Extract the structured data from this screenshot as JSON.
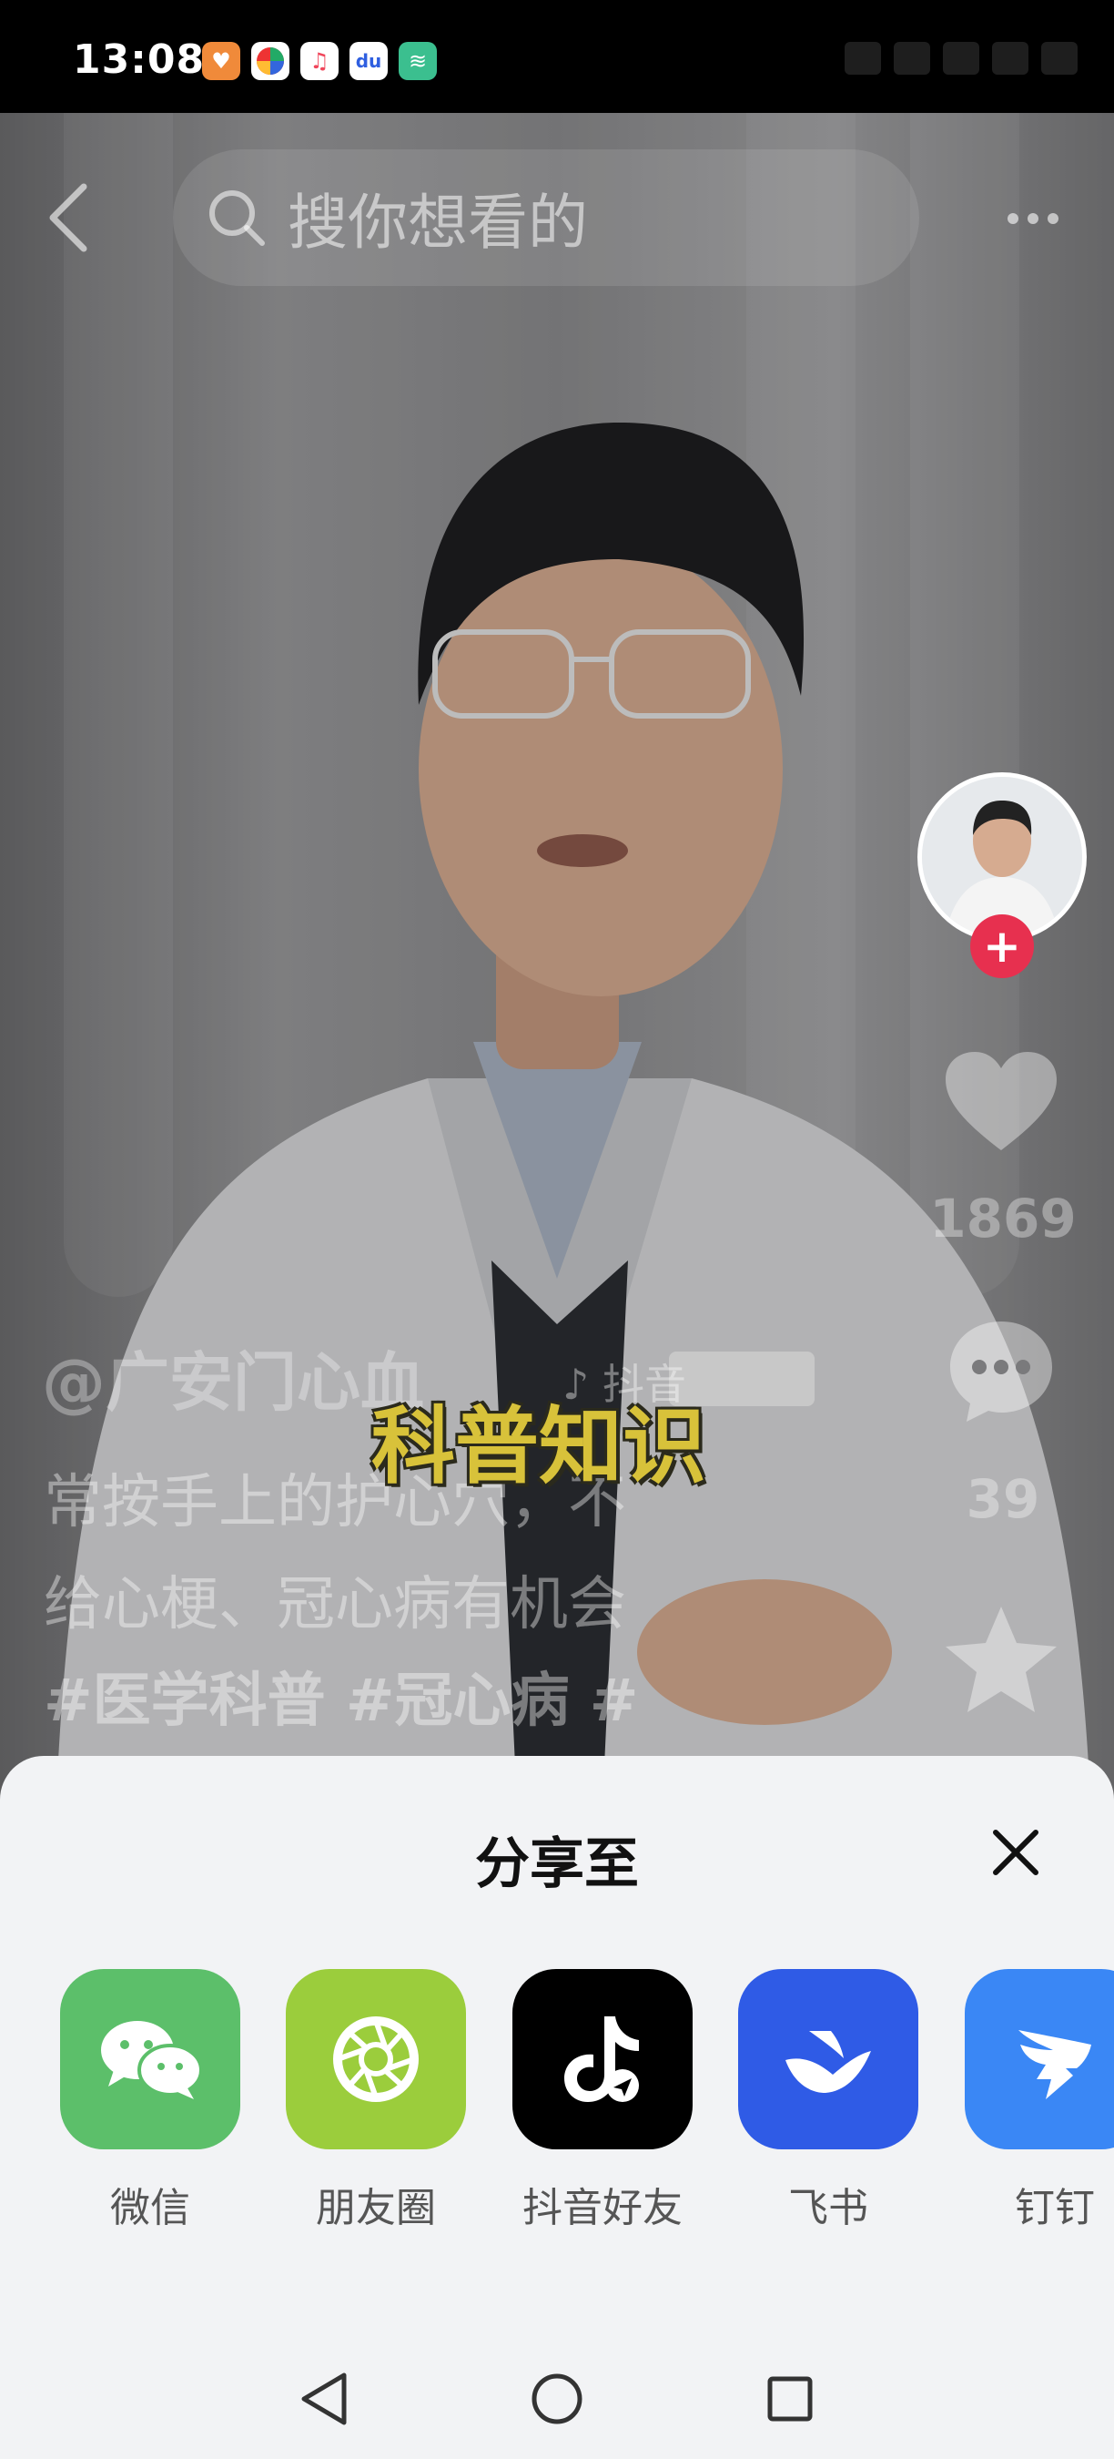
{
  "status_bar": {
    "time": "13:08",
    "apps": [
      {
        "name": "health-app",
        "color": "#f08a3a",
        "glyph": "♥"
      },
      {
        "name": "photos-app",
        "color": "#222222",
        "glyph": "◆"
      },
      {
        "name": "music-app",
        "color": "#ffffff",
        "glyph": "♫"
      },
      {
        "name": "baidu-app",
        "color": "#2f5fe0",
        "glyph": "du"
      },
      {
        "name": "wifi-app",
        "color": "#3bbf8f",
        "glyph": "≋"
      }
    ]
  },
  "video": {
    "search_placeholder": "搜你想看的",
    "author": "@广安门心血",
    "watermark": "♪ 抖音",
    "burned_caption": "科普知识",
    "caption_lines": [
      "常按手上的护心穴，不",
      "给心梗、冠心病有机会"
    ],
    "hashtags": "#医学科普 #冠心病 #",
    "likes": "1869",
    "comments": "39"
  },
  "share_sheet": {
    "title": "分享至",
    "targets": [
      {
        "label": "微信",
        "icon": "wechat-icon",
        "color": "#5cbf6a"
      },
      {
        "label": "朋友圈",
        "icon": "moments-icon",
        "color": "#9bcd3c"
      },
      {
        "label": "抖音好友",
        "icon": "douyin-icon",
        "color": "#000000"
      },
      {
        "label": "飞书",
        "icon": "feishu-icon",
        "color": "#2f5be6"
      },
      {
        "label": "钉钉",
        "icon": "dingtalk-icon",
        "color": "#3a87f5"
      }
    ]
  }
}
